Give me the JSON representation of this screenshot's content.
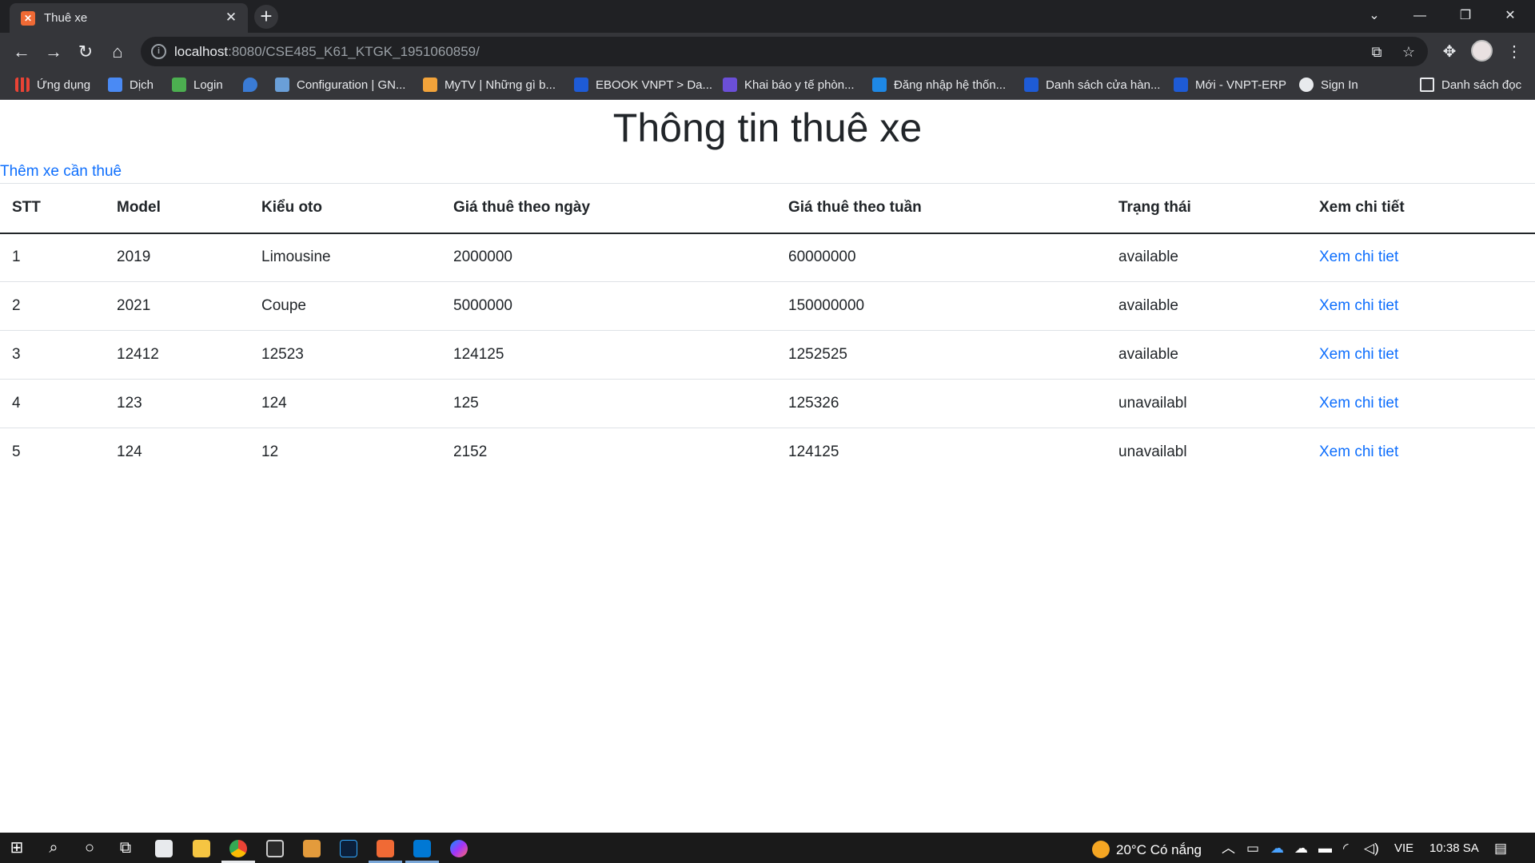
{
  "browser": {
    "tab_title": "Thuê xe",
    "tab_favicon": "xampp-icon",
    "url_host": "localhost",
    "url_rest": ":8080/CSE485_K61_KTGK_1951060859/",
    "bookmarks": [
      {
        "label": "Ứng dụng",
        "icon": "apps-grid-icon",
        "color": "#e8eaed"
      },
      {
        "label": "Dịch",
        "icon": "google-translate-icon",
        "color": "#4a8af4"
      },
      {
        "label": "Login",
        "icon": "pulse-icon",
        "color": "#4caf50"
      },
      {
        "label": "",
        "icon": "drop-icon",
        "color": "#3a7bd5"
      },
      {
        "label": "Configuration | GN...",
        "icon": "config-icon",
        "color": "#6a9fd8"
      },
      {
        "label": "MyTV | Những gì b...",
        "icon": "mytv-icon",
        "color": "#f2a33a"
      },
      {
        "label": "EBOOK VNPT > Da...",
        "icon": "vnpt-icon",
        "color": "#1e5bd6"
      },
      {
        "label": "Khai báo y tế phòn...",
        "icon": "form-icon",
        "color": "#6b4fd8"
      },
      {
        "label": "Đăng nhập hệ thốn...",
        "icon": "x-logo-icon",
        "color": "#1e88e5"
      },
      {
        "label": "Danh sách cửa hàn...",
        "icon": "vnpt-icon",
        "color": "#1e5bd6"
      },
      {
        "label": "Mới - VNPT-ERP",
        "icon": "vnpt-icon",
        "color": "#1e5bd6"
      },
      {
        "label": "Sign In",
        "icon": "globe-icon",
        "color": "#e8eaed"
      }
    ],
    "reading_list": "Danh sách đọc"
  },
  "page": {
    "title": "Thông tin thuê xe",
    "add_link": "Thêm xe cần thuê",
    "table": {
      "headers": [
        "STT",
        "Model",
        "Kiểu oto",
        "Giá thuê theo ngày",
        "Giá thuê theo tuần",
        "Trạng thái",
        "Xem chi tiết"
      ],
      "rows": [
        [
          "1",
          "2019",
          "Limousine",
          "2000000",
          "60000000",
          "available",
          "Xem chi tiet"
        ],
        [
          "2",
          "2021",
          "Coupe",
          "5000000",
          "150000000",
          "available",
          "Xem chi tiet"
        ],
        [
          "3",
          "12412",
          "12523",
          "124125",
          "1252525",
          "available",
          "Xem chi tiet"
        ],
        [
          "4",
          "123",
          "124",
          "125",
          "125326",
          "unavailabl",
          "Xem chi tiet"
        ],
        [
          "5",
          "124",
          "12",
          "2152",
          "124125",
          "unavailabl",
          "Xem chi tiet"
        ]
      ]
    }
  },
  "taskbar": {
    "weather": "20°C  Có nắng",
    "language": "VIE",
    "time": "10:38 SA"
  }
}
